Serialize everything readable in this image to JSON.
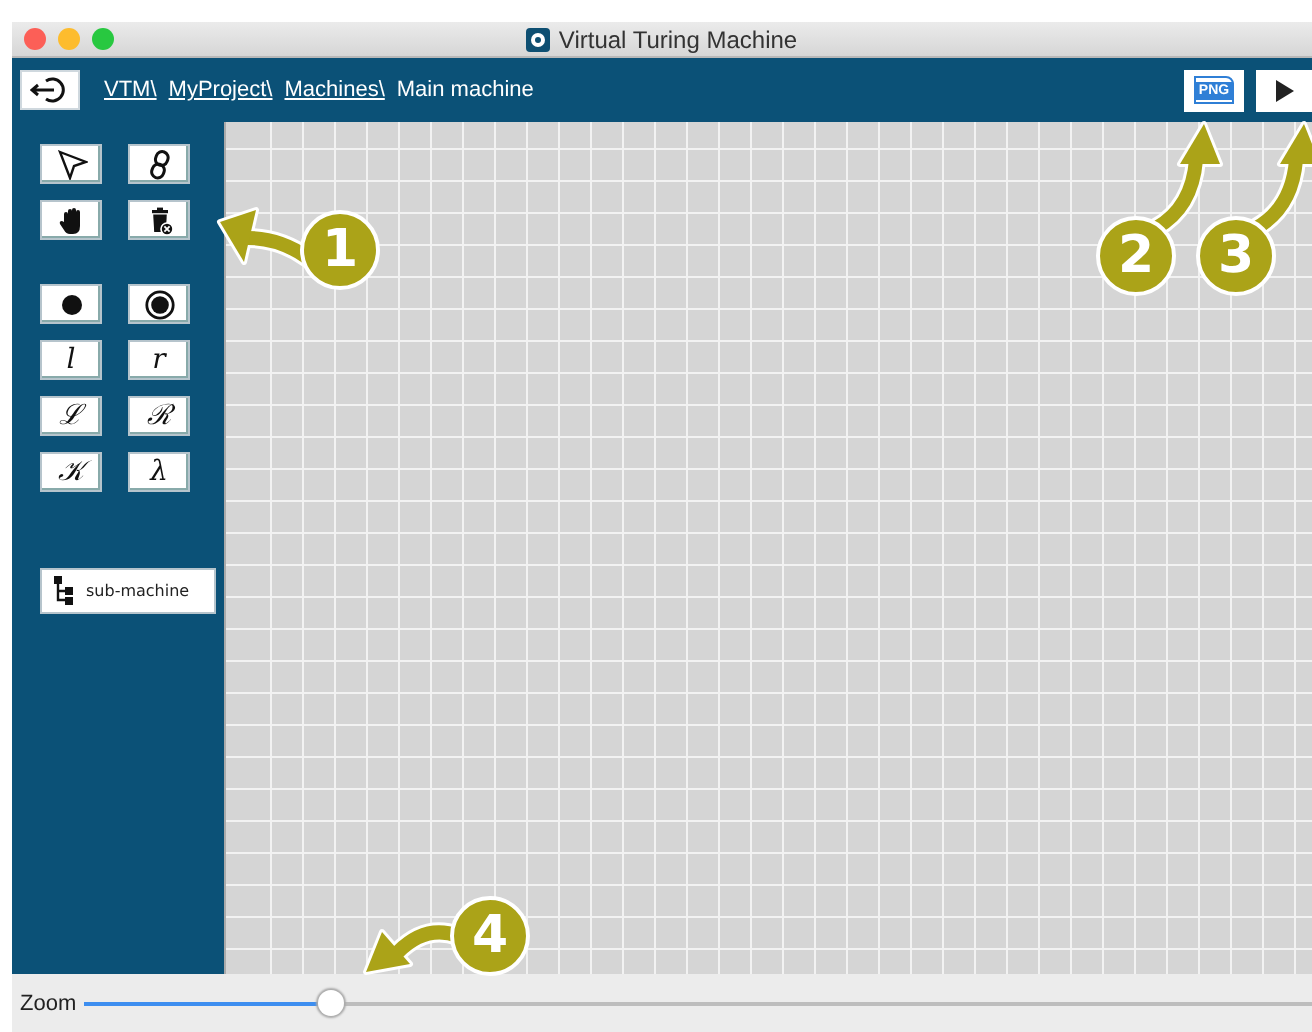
{
  "window": {
    "title": "Virtual Turing Machine"
  },
  "breadcrumb": [
    {
      "label": "VTM\\",
      "kind": "link"
    },
    {
      "label": "MyProject\\",
      "kind": "link"
    },
    {
      "label": "Machines\\",
      "kind": "link"
    },
    {
      "label": "Main machine",
      "kind": "current"
    }
  ],
  "header_buttons": [
    {
      "kind": "png",
      "label": "PNG"
    },
    {
      "kind": "run"
    }
  ],
  "tools": [
    {
      "kind": "select"
    },
    {
      "kind": "link"
    },
    {
      "kind": "hand"
    },
    {
      "kind": "delete"
    },
    {
      "kind": "state"
    },
    {
      "kind": "final-state"
    },
    {
      "kind": "symbol",
      "label": "l"
    },
    {
      "kind": "symbol",
      "label": "r"
    },
    {
      "kind": "symbol",
      "label": "ℒ"
    },
    {
      "kind": "symbol",
      "label": "ℛ"
    },
    {
      "kind": "symbol",
      "label": "𝒦"
    },
    {
      "kind": "symbol",
      "label": "λ"
    }
  ],
  "submachine": {
    "label": "sub-machine"
  },
  "zoom": {
    "label": "Zoom",
    "level": 0.2
  },
  "callouts": [
    {
      "number": "1",
      "kind": "left"
    },
    {
      "number": "2",
      "kind": "up"
    },
    {
      "number": "3",
      "kind": "up"
    },
    {
      "number": "4",
      "kind": "down-left"
    }
  ]
}
